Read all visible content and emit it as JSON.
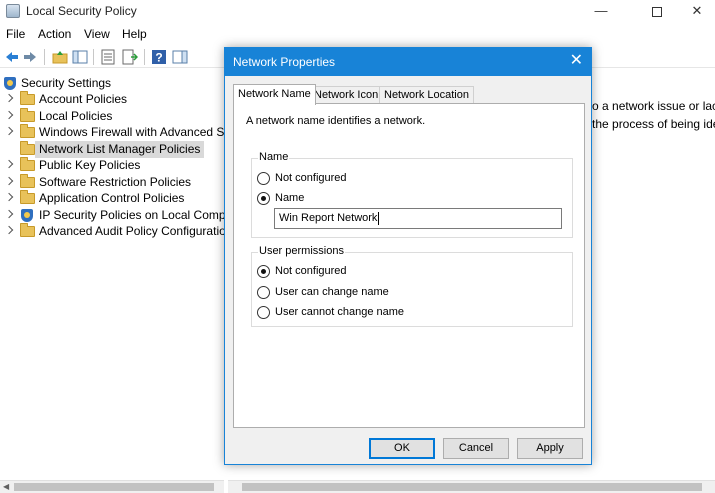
{
  "window": {
    "title": "Local Security Policy",
    "minimize_glyph": "—",
    "close_glyph": "✕"
  },
  "menu": [
    "File",
    "Action",
    "View",
    "Help"
  ],
  "toolbar_icons": [
    "back-arrow-icon",
    "forward-arrow-icon",
    "folder-up-icon",
    "show-hide-tree-icon",
    "properties-icon",
    "export-list-icon",
    "help-icon",
    "show-action-pane-icon"
  ],
  "tree": {
    "root": "Security Settings",
    "items": [
      "Account Policies",
      "Local Policies",
      "Windows Firewall with Advanced Secu",
      "Network List Manager Policies",
      "Public Key Policies",
      "Software Restriction Policies",
      "Application Control Policies",
      "IP Security Policies on Local Compute",
      "Advanced Audit Policy Configuration"
    ],
    "selected_index": 3
  },
  "right_pane": {
    "line1": "o a network issue or lack",
    "line2": "the process of being ident"
  },
  "dialog": {
    "title": "Network Properties",
    "close_glyph": "✕",
    "tabs": [
      "Network Name",
      "Network Icon",
      "Network Location"
    ],
    "active_tab": 0,
    "description": "A network name identifies a network.",
    "name_group": {
      "label": "Name",
      "options": [
        "Not configured",
        "Name"
      ],
      "selected": 1,
      "input_value": "Win Report Network"
    },
    "permissions_group": {
      "label": "User permissions",
      "options": [
        "Not configured",
        "User can change name",
        "User cannot change name"
      ],
      "selected": 0
    },
    "buttons": {
      "ok": "OK",
      "cancel": "Cancel",
      "apply": "Apply"
    }
  },
  "colors": {
    "accent": "#1883d7",
    "folder": "#e8c25a",
    "selection": "#d9d9d9"
  }
}
